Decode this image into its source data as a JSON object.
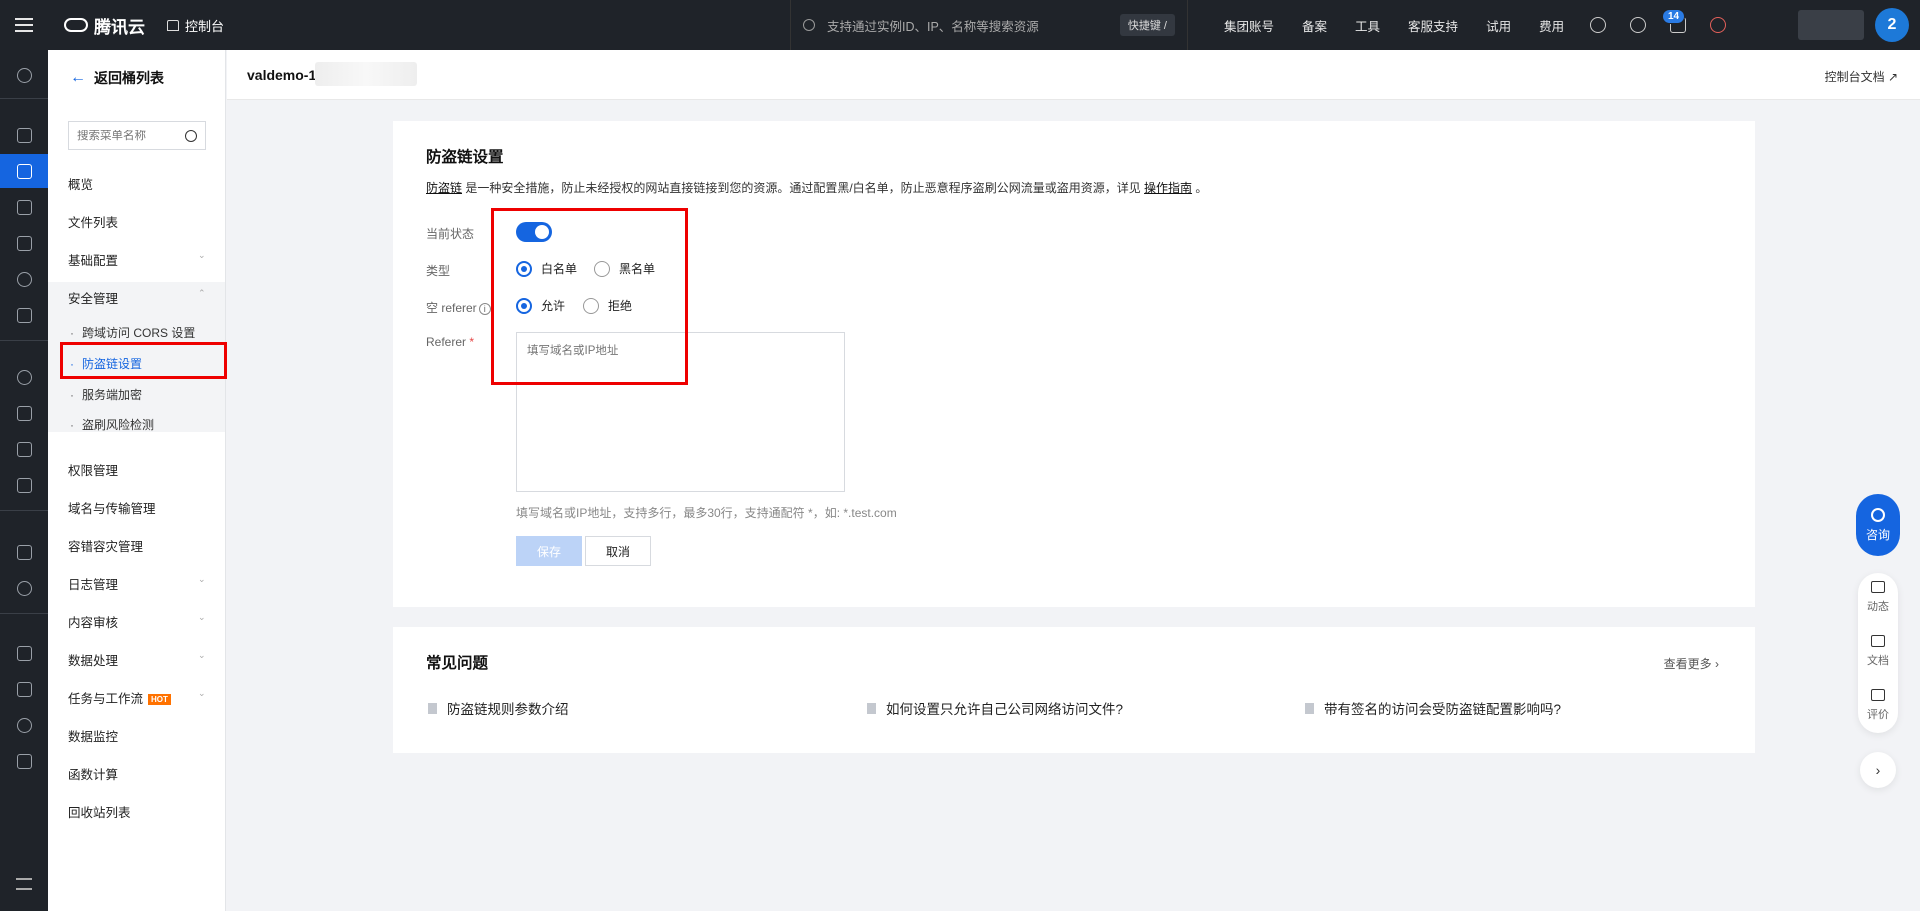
{
  "topbar": {
    "brand": "腾讯云",
    "console": "控制台",
    "search_placeholder": "支持通过实例ID、IP、名称等搜索资源",
    "shortcut": "快捷键 /",
    "nav": [
      "集团账号",
      "备案",
      "工具",
      "客服支持",
      "试用",
      "费用"
    ],
    "notification_count": "14",
    "avatar_text": "2"
  },
  "sidebar": {
    "back_label": "返回桶列表",
    "search_placeholder": "搜索菜单名称",
    "items": [
      {
        "label": "概览"
      },
      {
        "label": "文件列表"
      },
      {
        "label": "基础配置"
      },
      {
        "label": "安全管理"
      },
      {
        "label": "权限管理"
      },
      {
        "label": "域名与传输管理"
      },
      {
        "label": "容错容灾管理"
      },
      {
        "label": "日志管理"
      },
      {
        "label": "内容审核"
      },
      {
        "label": "数据处理"
      },
      {
        "label": "任务与工作流"
      },
      {
        "label": "数据监控"
      },
      {
        "label": "函数计算"
      },
      {
        "label": "回收站列表"
      }
    ],
    "hot_badge": "HOT",
    "security_sub": [
      {
        "label": "跨域访问 CORS 设置"
      },
      {
        "label": "防盗链设置"
      },
      {
        "label": "服务端加密"
      },
      {
        "label": "盗刷风险检测"
      }
    ]
  },
  "header": {
    "bucket_name": "valdemo-1",
    "doc_link": "控制台文档"
  },
  "hotlink": {
    "title": "防盗链设置",
    "desc_link": "防盗链",
    "desc_text": " 是一种安全措施，防止未经授权的网站直接链接到您的资源。通过配置黑/白名单，防止恶意程序盗刷公网流量或盗用资源，详见 ",
    "desc_guide": "操作指南",
    "desc_end": " 。",
    "status_label": "当前状态",
    "status_enabled": true,
    "type_label": "类型",
    "type_options": [
      "白名单",
      "黑名单"
    ],
    "type_selected": "白名单",
    "empty_referer_label": "空 referer",
    "empty_referer_options": [
      "允许",
      "拒绝"
    ],
    "empty_referer_selected": "允许",
    "referer_label": "Referer",
    "referer_required": "*",
    "referer_placeholder": "填写域名或IP地址",
    "referer_value": "",
    "hint": "填写域名或IP地址，支持多行，最多30行，支持通配符 *，如: *.test.com",
    "save": "保存",
    "cancel": "取消"
  },
  "faq": {
    "title": "常见问题",
    "more": "查看更多",
    "items": [
      "防盗链规则参数介绍",
      "如何设置只允许自己公司网络访问文件?",
      "带有签名的访问会受防盗链配置影响吗?"
    ]
  },
  "float": {
    "consult": "咨询",
    "items": [
      "动态",
      "文档",
      "评价"
    ]
  },
  "colors": {
    "accent": "#1565e0",
    "topbar": "#1f2329",
    "highlight": "#e00000"
  }
}
